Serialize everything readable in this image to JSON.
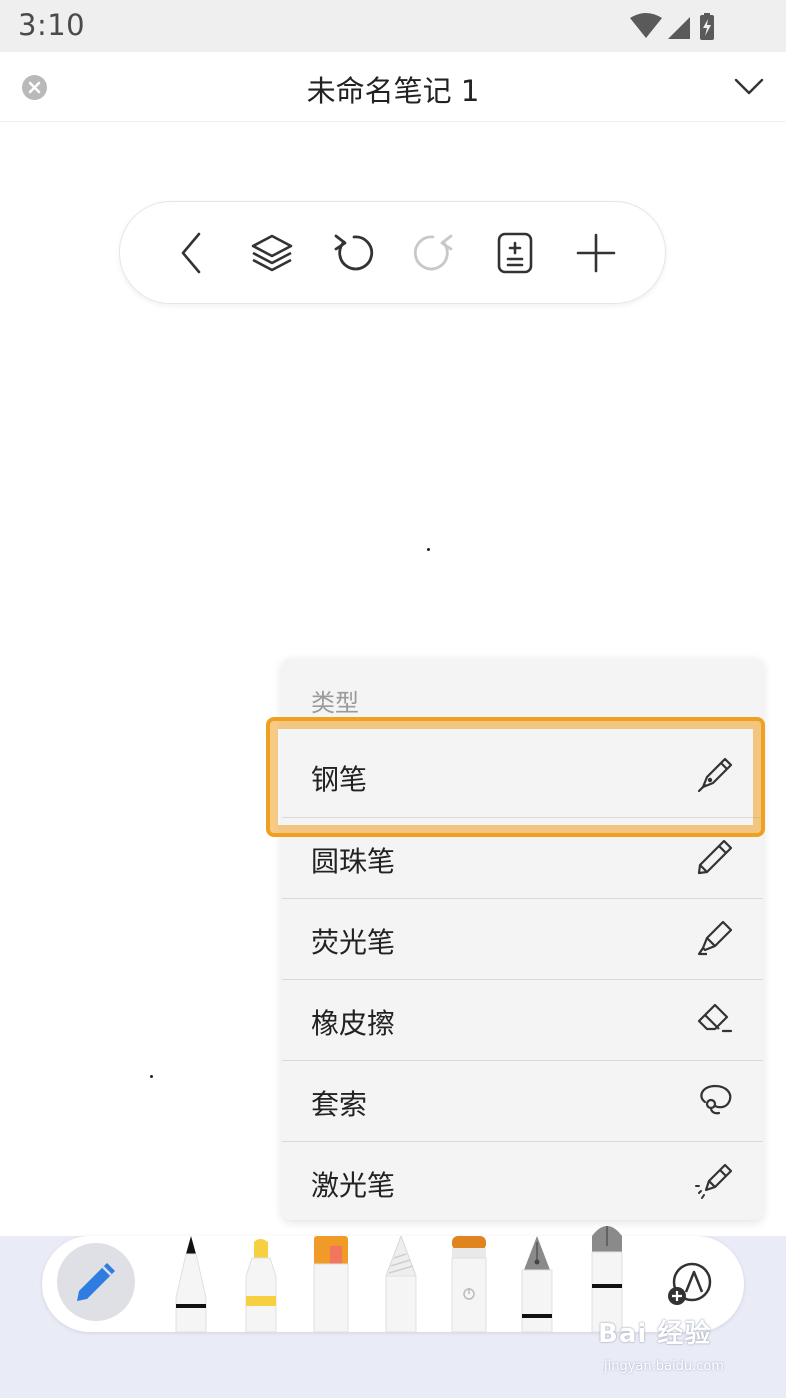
{
  "status_bar": {
    "time": "3:10"
  },
  "header": {
    "title": "未命名笔记 1"
  },
  "toolbar": {
    "icons": [
      "back-icon",
      "layers-icon",
      "undo-icon",
      "redo-icon",
      "page-icon",
      "add-icon"
    ]
  },
  "menu": {
    "header": "类型",
    "items": [
      {
        "label": "钢笔",
        "icon": "fountain-pen-icon",
        "highlighted": true
      },
      {
        "label": "圆珠笔",
        "icon": "ballpoint-pen-icon"
      },
      {
        "label": "荧光笔",
        "icon": "highlighter-icon"
      },
      {
        "label": "橡皮擦",
        "icon": "eraser-icon"
      },
      {
        "label": "套索",
        "icon": "lasso-icon"
      },
      {
        "label": "激光笔",
        "icon": "laser-pointer-icon"
      }
    ]
  },
  "colors": {
    "highlight": "#f0a020",
    "active_pen": "#2f7de1",
    "tray_background": "#e9ecf7"
  },
  "watermark": {
    "text": "Bai 经验",
    "url": "jingyan.baidu.com"
  }
}
